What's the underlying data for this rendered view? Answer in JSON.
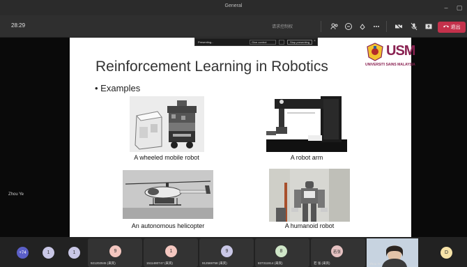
{
  "window": {
    "title": "General"
  },
  "toolbar": {
    "timer": "28:29",
    "muted_text": "请求控制权",
    "leave_label": "退出",
    "icons": [
      "people-icon",
      "chat-icon",
      "reactions-icon",
      "more-icon",
      "camera-off-icon",
      "mic-off-icon",
      "share-icon",
      "phone-icon"
    ]
  },
  "presenting_bar": {
    "label": "Presenting...",
    "give_control": "Give control",
    "stop": "Stop presenting"
  },
  "slide": {
    "title": "Reinforcement Learning in Robotics",
    "bullet": "• Examples",
    "logo_text": "UNIVERSITI SAINS MALAYSIA",
    "logo_abbr": "USM",
    "captions": {
      "wheeled": "A wheeled mobile robot",
      "arm": "A robot arm",
      "heli": "An autonomous helicopter",
      "humanoid": "A humanoid robot"
    }
  },
  "presenter_name": "Zhou Ye",
  "participants": {
    "overflow": "+74",
    "tiles": [
      {
        "initial": "1",
        "label": ""
      },
      {
        "initial": "1",
        "label": ""
      },
      {
        "initial": "9",
        "label": "921202945 (来宾)",
        "color": "#f4c7c0"
      },
      {
        "initial": "1",
        "label": "1511480747 (来宾)",
        "color": "#f4c7c0"
      },
      {
        "initial": "9",
        "label": "912569758 (来宾)",
        "color": "#c9c7e6"
      },
      {
        "initial": "8",
        "label": "837311914 (来宾)",
        "color": "#cfe6c8"
      },
      {
        "initial": "若张",
        "label": "若 张 (来宾)",
        "color": "#e6c2c2"
      },
      {
        "initial": "",
        "label": "Zhou Ye"
      },
      {
        "initial": "D",
        "label": "",
        "color": "#f7e3a8"
      }
    ]
  }
}
